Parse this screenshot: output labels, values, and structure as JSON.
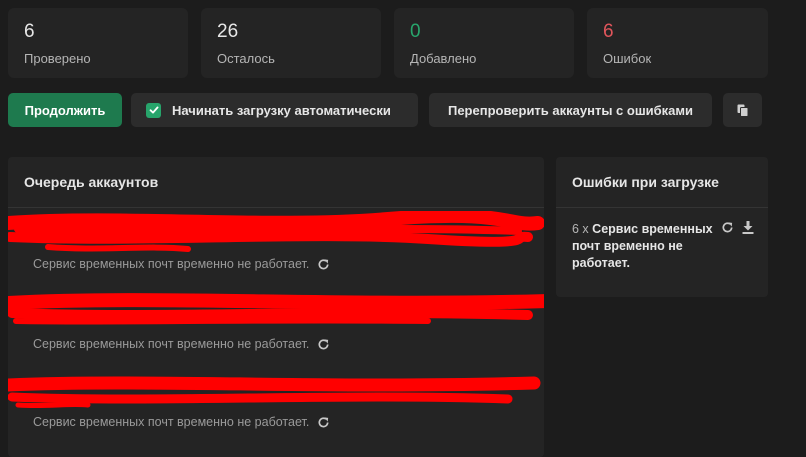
{
  "stats": [
    {
      "value": "6",
      "label": "Проверено",
      "color": "#e6e6e6"
    },
    {
      "value": "26",
      "label": "Осталось",
      "color": "#e6e6e6"
    },
    {
      "value": "0",
      "label": "Добавлено",
      "color": "#28a56c"
    },
    {
      "value": "6",
      "label": "Ошибок",
      "color": "#e0555b"
    }
  ],
  "toolbar": {
    "continue_label": "Продолжить",
    "auto_label": "Начинать загрузку автоматически",
    "auto_checked": true,
    "recheck_label": "Перепроверить аккаунты с ошибками",
    "copy_icon": "copy-icon"
  },
  "queue": {
    "title": "Очередь аккаунтов",
    "items": [
      {
        "status": "Сервис временных почт временно не работает.",
        "icon": "refresh-icon"
      },
      {
        "status": "Сервис временных почт временно не работает.",
        "icon": "refresh-icon"
      },
      {
        "status": "Сервис временных почт временно не работает.",
        "icon": "refresh-icon"
      }
    ]
  },
  "errors": {
    "title": "Ошибки при загрузке",
    "items": [
      {
        "count": "6 x",
        "text": "Сервис временных почт временно не работает.",
        "icons": [
          "refresh-icon",
          "download-icon"
        ]
      }
    ]
  },
  "colors": {
    "background": "#1c1c1c",
    "card": "#242424",
    "accent_green": "#1e7a4e",
    "checkbox_green": "#27a46b",
    "error_red": "#e0555b",
    "redaction": "#ff0000"
  }
}
